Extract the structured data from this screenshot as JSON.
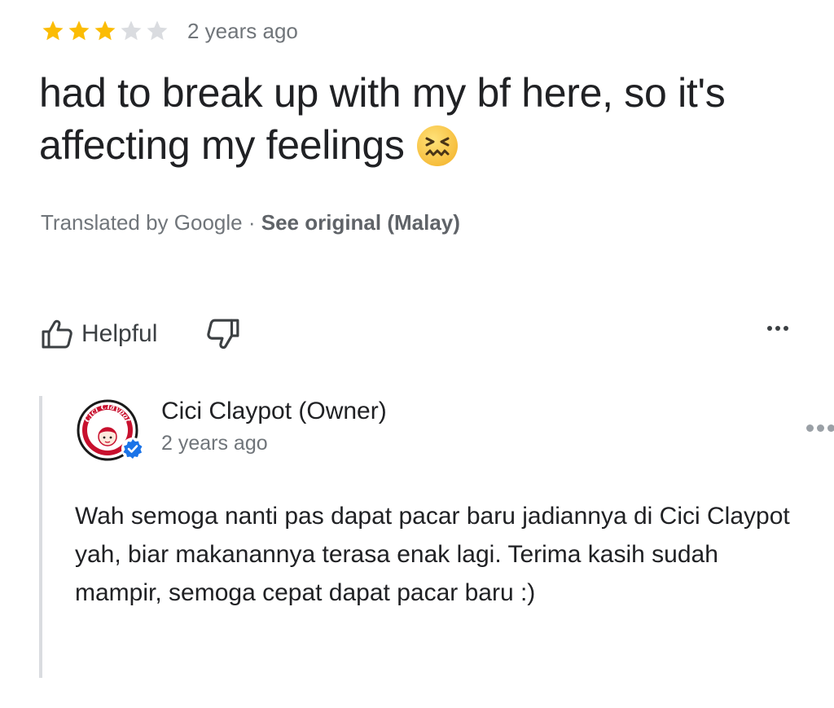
{
  "review": {
    "rating": 3,
    "max_rating": 5,
    "star_color": "#fbbc04",
    "empty_star_color": "#dadce0",
    "date": "2 years ago",
    "text": "had to break up with my bf here, so it's affecting my feelings",
    "emoji": "confounded-face-emoji"
  },
  "translation": {
    "prefix": "Translated by Google · ",
    "link": "See original (Malay)"
  },
  "actions": {
    "helpful_label": "Helpful",
    "helpful_icon": "thumbs-up-icon",
    "unhelpful_icon": "thumbs-down-icon",
    "more_icon": "more-horizontal-icon"
  },
  "owner_response": {
    "name": "Cici Claypot (Owner)",
    "date": "2 years ago",
    "avatar_logo_text": "Cici Claypot",
    "verified_color": "#1a73e8",
    "text": "Wah semoga nanti pas dapat pacar baru jadiannya di Cici Claypot yah, biar makanannya terasa enak lagi. Terima kasih sudah mampir, semoga cepat dapat pacar baru :)"
  }
}
